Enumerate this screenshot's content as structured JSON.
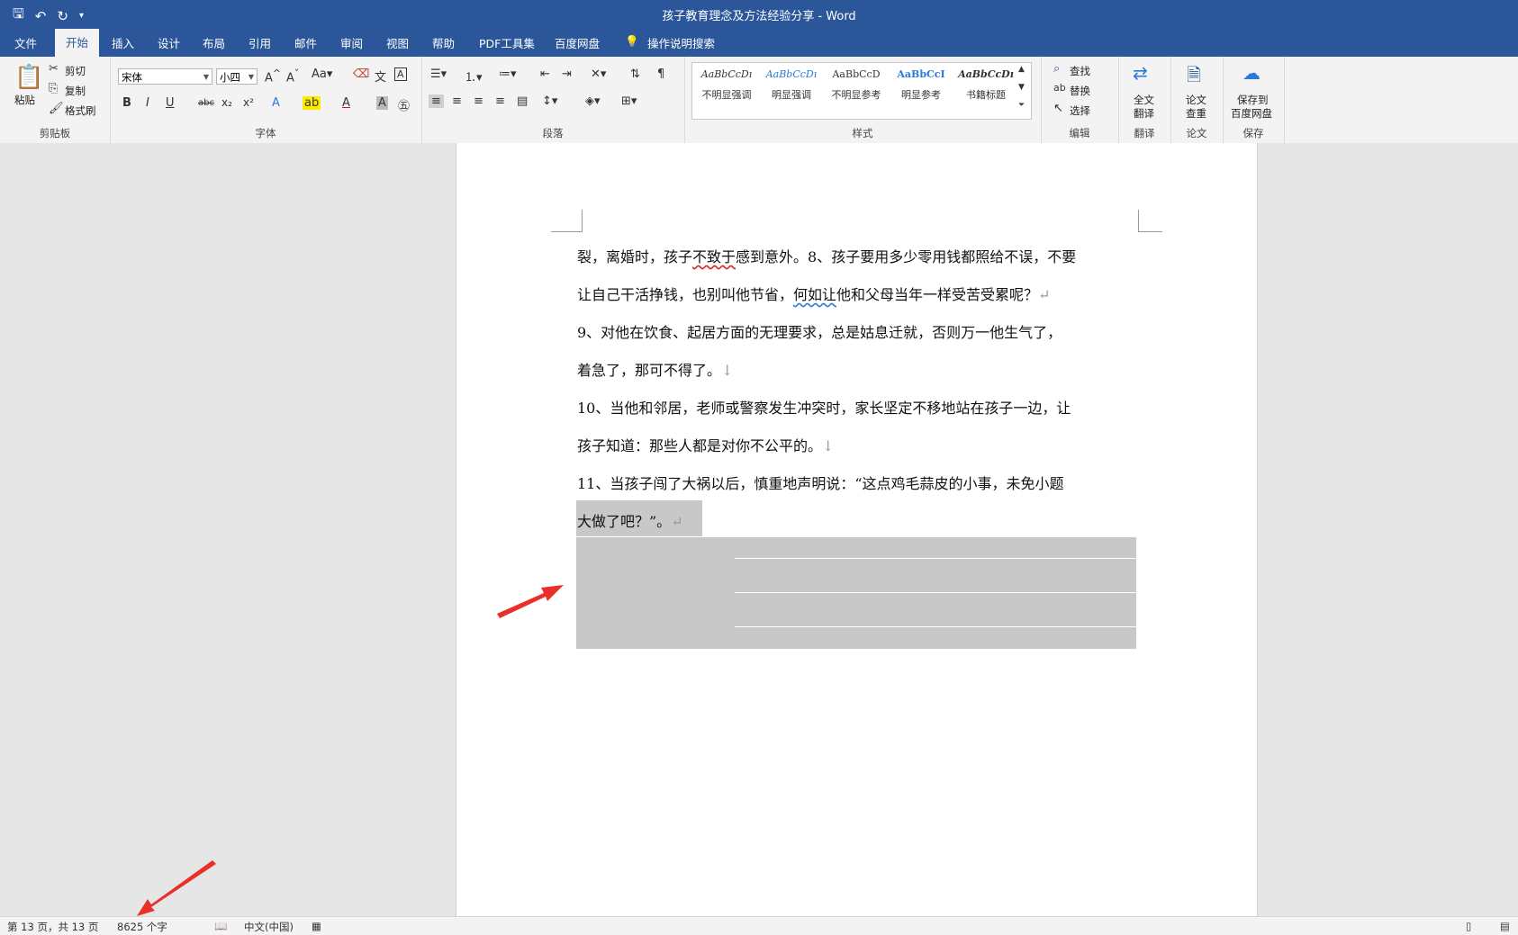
{
  "titlebar": {
    "doc_title": "孩子教育理念及方法经验分享  -  Word",
    "qat_icons": [
      "save-icon",
      "undo-icon",
      "redo-icon",
      "customize-icon"
    ]
  },
  "tabs": [
    "文件",
    "开始",
    "插入",
    "设计",
    "布局",
    "引用",
    "邮件",
    "审阅",
    "视图",
    "帮助",
    "PDF工具集",
    "百度网盘",
    "操作说明搜索"
  ],
  "active_tab": "开始",
  "clipboard": {
    "paste": "粘贴",
    "cut": "剪切",
    "copy": "复制",
    "format_painter": "格式刷",
    "label": "剪贴板"
  },
  "font": {
    "name": "宋体",
    "size": "小四",
    "bold": "B",
    "italic": "I",
    "underline": "U",
    "strike": "abc",
    "sub": "x₂",
    "sup": "x²",
    "label": "字体"
  },
  "paragraph": {
    "label": "段落"
  },
  "styles": {
    "label": "样式",
    "items": [
      {
        "sample": "AaBbCcDı",
        "name": "不明显强调"
      },
      {
        "sample": "AaBbCcDı",
        "name": "明显强调"
      },
      {
        "sample": "AaBbCcD",
        "name": "不明显参考"
      },
      {
        "sample": "AaBbCcI",
        "name": "明显参考"
      },
      {
        "sample": "AaBbCcDı",
        "name": "书籍标题"
      }
    ]
  },
  "editing": {
    "find": "查找",
    "replace": "替换",
    "select": "选择",
    "label": "编辑"
  },
  "translate": {
    "line1": "全文",
    "line2": "翻译",
    "label": "翻译"
  },
  "paper": {
    "line1": "论文",
    "line2": "查重",
    "label": "论文"
  },
  "save_cloud": {
    "line1": "保存到",
    "line2": "百度网盘",
    "label": "保存"
  },
  "document": {
    "lines": [
      {
        "pre": "裂，离婚时，孩子",
        "wavy": "不致于",
        "post": "感到意外。8、孩子要用多少零用钱都照给不误，不要",
        "mark": ""
      },
      {
        "pre": "让自己干活挣钱，也别叫他节省，",
        "wavy": "何如让",
        "post": "他和父母当年一样受苦受累呢？",
        "mark": "↵"
      },
      {
        "pre": " 9、对他在饮食、起居方面的无理要求，总是姑息迁就，否则万一他生气了，",
        "wavy": "",
        "post": "",
        "mark": ""
      },
      {
        "pre": "着急了，那可不得了。",
        "wavy": "",
        "post": "",
        "mark": "↓"
      },
      {
        "pre": " 10、当他和邻居，老师或警察发生冲突时，家长坚定不移地站在孩子一边，让",
        "wavy": "",
        "post": "",
        "mark": ""
      },
      {
        "pre": "孩子知道：那些人都是对你不公平的。",
        "wavy": "",
        "post": "",
        "mark": "↓"
      },
      {
        "pre": " 11、当孩子闯了大祸以后，慎重地声明说：“这点鸡毛蒜皮的小事，未免小题",
        "wavy": "",
        "post": "",
        "mark": ""
      },
      {
        "pre": "大做了吧？”。",
        "wavy": "",
        "post": "",
        "mark": "↵"
      }
    ]
  },
  "status": {
    "page": "第 13 页，共 13 页",
    "words": "8625 个字",
    "lang": "中文(中国)"
  },
  "colors": {
    "brand": "#2b579a",
    "arrow": "#e8302a",
    "selection": "#c8c8c8"
  }
}
